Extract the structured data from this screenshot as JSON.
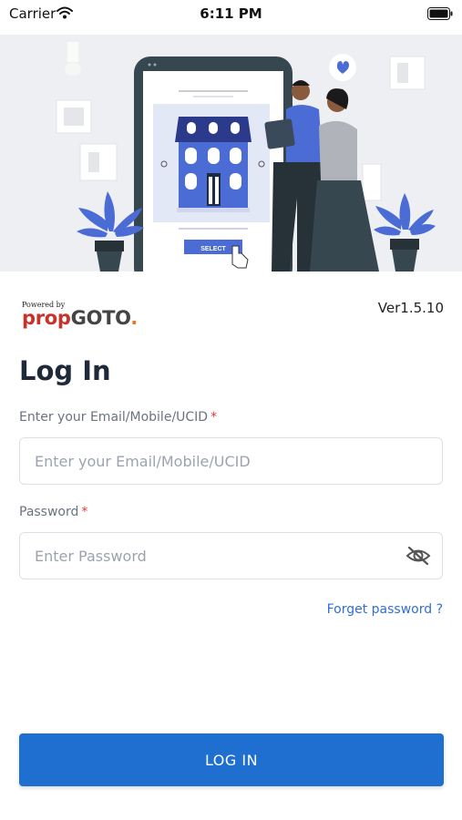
{
  "status_bar": {
    "carrier": "Carrier",
    "time": "6:11 PM"
  },
  "hero": {
    "select_label": "SELECT"
  },
  "brand": {
    "powered_by": "Powered by",
    "prop": "prop",
    "goto": "GOTO",
    "dot": "."
  },
  "version": "Ver1.5.10",
  "title": "Log In",
  "email": {
    "label": "Enter your Email/Mobile/UCID",
    "required_mark": "*",
    "placeholder": "Enter your Email/Mobile/UCID",
    "value": ""
  },
  "password": {
    "label": "Password",
    "required_mark": "*",
    "placeholder": "Enter Password",
    "value": ""
  },
  "forgot_password": "Forget password ?",
  "login_button": "LOG IN",
  "colors": {
    "primary": "#1f6fd1",
    "link": "#2f6fd6",
    "required": "#e53935",
    "brand_red": "#c7332b",
    "illustration_blue": "#4a6cd4"
  },
  "icons": {
    "wifi": "wifi-icon",
    "battery": "battery-icon",
    "password_visibility": "eye-slash-icon"
  }
}
